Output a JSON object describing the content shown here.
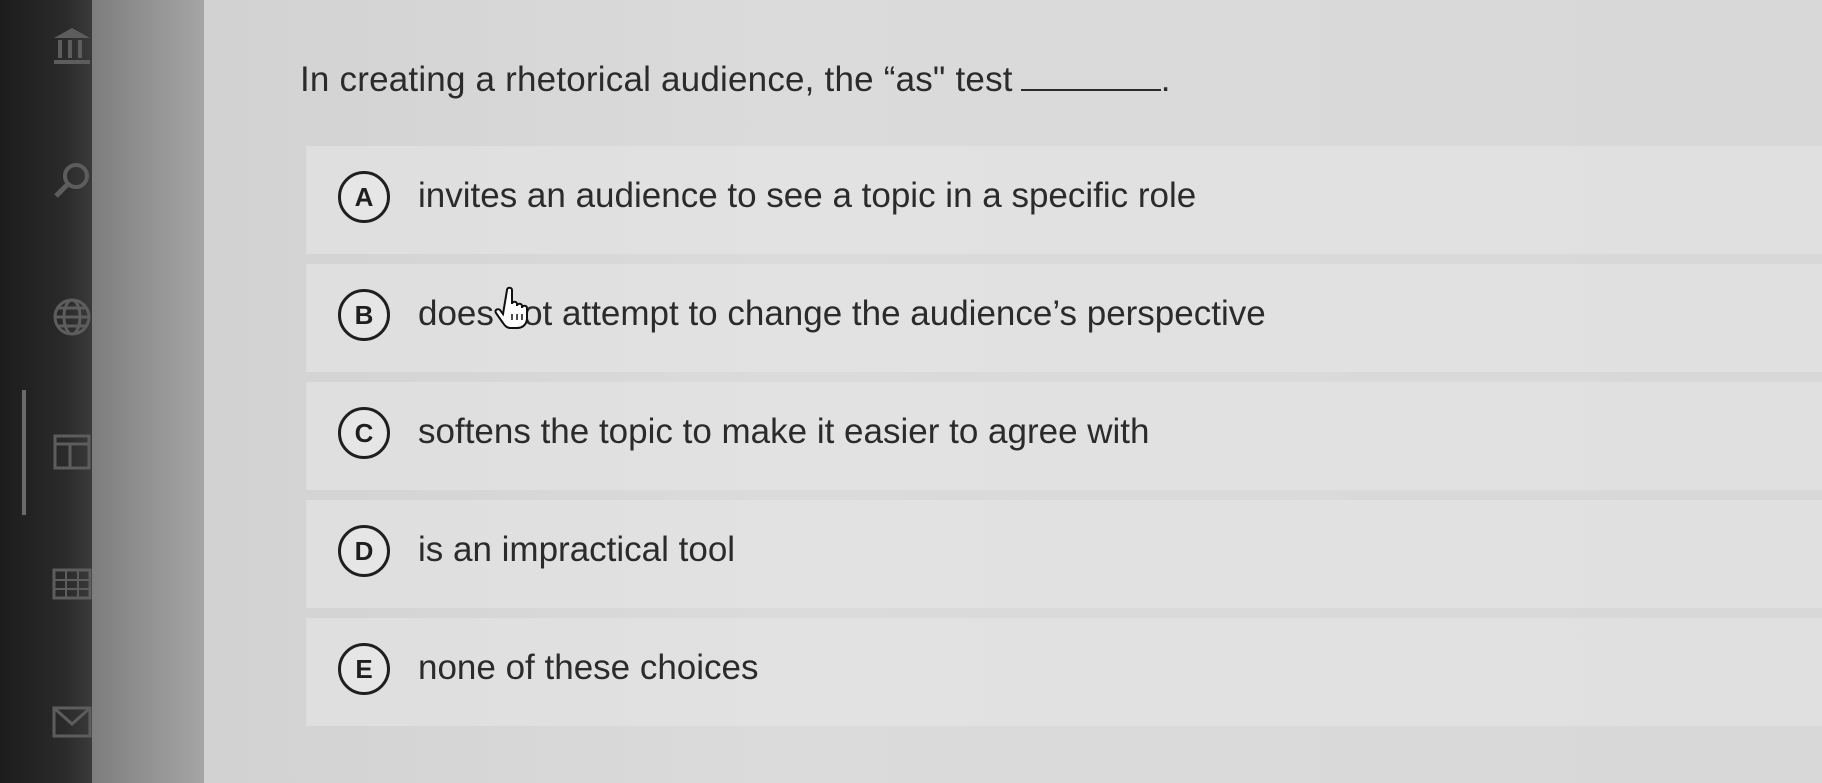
{
  "question": {
    "prefix": "In creating a rhetorical audience, the “as\" test",
    "suffix": "."
  },
  "options": [
    {
      "letter": "A",
      "text": "invites an audience to see a topic in a specific role"
    },
    {
      "letter": "B",
      "text": "does not attempt to change the audience’s perspective"
    },
    {
      "letter": "C",
      "text": "softens the topic to make it easier to agree with"
    },
    {
      "letter": "D",
      "text": "is an impractical tool"
    },
    {
      "letter": "E",
      "text": "none of these choices"
    }
  ],
  "nav_icons": [
    "library-icon",
    "search-icon",
    "globe-icon",
    "calendar-icon",
    "grid-icon",
    "mail-icon"
  ],
  "colors": {
    "text": "#2b2b2b",
    "background": "#d9d9d9",
    "rail": "#222222"
  }
}
